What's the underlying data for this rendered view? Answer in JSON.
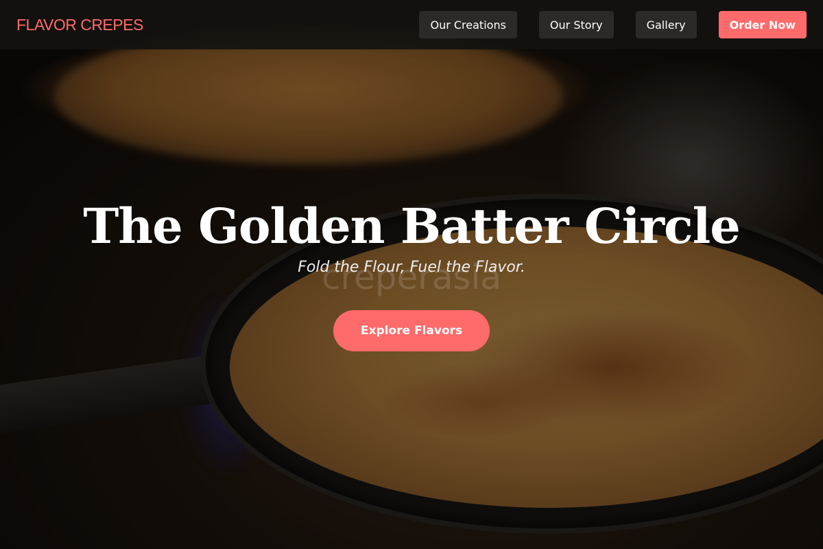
{
  "header": {
    "brand": "FLAVOR CREPES",
    "nav": [
      {
        "label": "Our Creations"
      },
      {
        "label": "Our Story"
      },
      {
        "label": "Gallery"
      }
    ],
    "cta_label": "Order Now"
  },
  "hero": {
    "title": "The Golden Batter Circle",
    "subtitle": "Fold the Flour, Fuel the Flavor.",
    "watermark": "creperasia",
    "cta_label": "Explore Flavors"
  },
  "colors": {
    "accent": "#ff6b6b",
    "header_bg": "#141210",
    "nav_button_bg": "#2c2a28",
    "text": "#ffffff"
  }
}
